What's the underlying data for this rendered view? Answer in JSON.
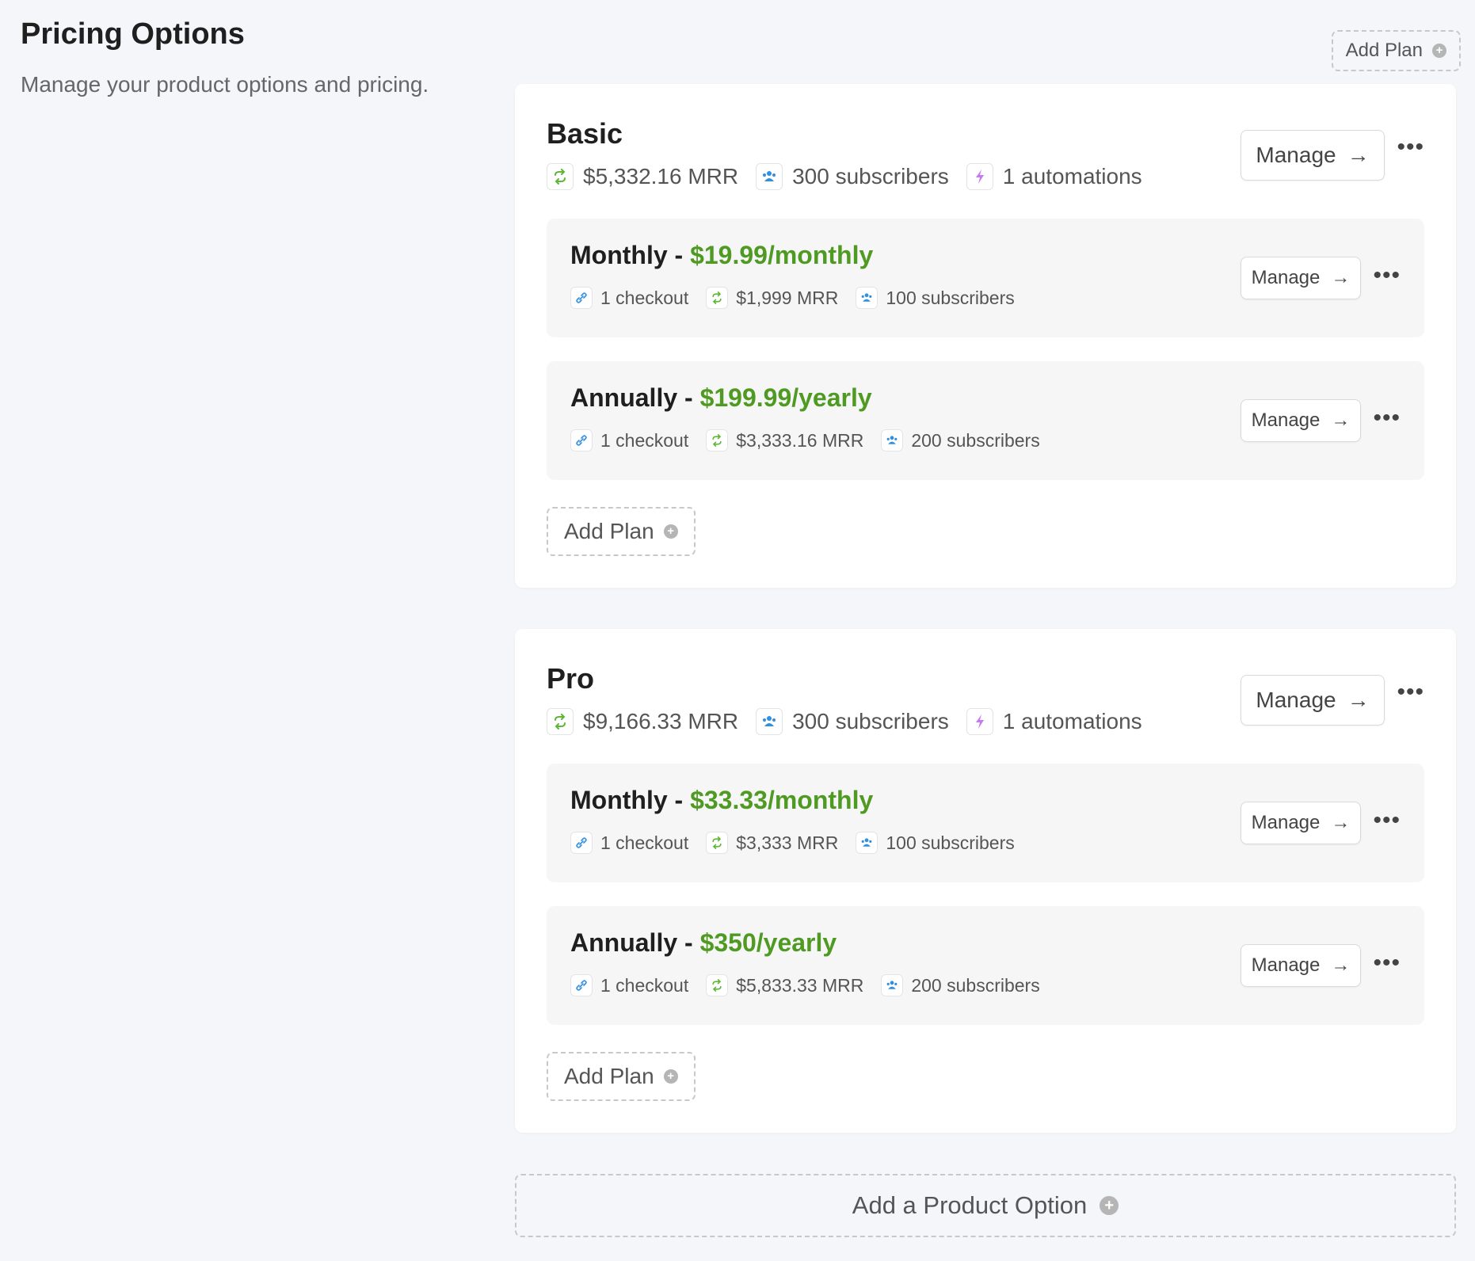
{
  "page": {
    "title": "Pricing Options",
    "subtitle": "Manage your product options and pricing.",
    "add_plan_label": "Add Plan",
    "add_product_option_label": "Add a Product Option"
  },
  "colors": {
    "price": "#4f9a22",
    "mrr_icon": "#5fb536",
    "subscribers_icon": "#2f8fe0",
    "automation_icon": "#c27cf2"
  },
  "products": [
    {
      "name": "Basic",
      "mrr": "$5,332.16 MRR",
      "subscribers": "300 subscribers",
      "automations": "1 automations",
      "manage_label": "Manage",
      "add_plan_label": "Add Plan",
      "plans": [
        {
          "name": "Monthly - ",
          "price": "$19.99/monthly",
          "checkout": "1 checkout",
          "mrr": "$1,999 MRR",
          "subscribers": "100 subscribers",
          "manage_label": "Manage"
        },
        {
          "name": "Annually - ",
          "price": "$199.99/yearly",
          "checkout": "1 checkout",
          "mrr": "$3,333.16 MRR",
          "subscribers": "200 subscribers",
          "manage_label": "Manage"
        }
      ]
    },
    {
      "name": "Pro",
      "mrr": "$9,166.33 MRR",
      "subscribers": "300 subscribers",
      "automations": "1 automations",
      "manage_label": "Manage",
      "add_plan_label": "Add Plan",
      "plans": [
        {
          "name": "Monthly - ",
          "price": "$33.33/monthly",
          "checkout": "1 checkout",
          "mrr": "$3,333 MRR",
          "subscribers": "100 subscribers",
          "manage_label": "Manage"
        },
        {
          "name": "Annually - ",
          "price": "$350/yearly",
          "checkout": "1 checkout",
          "mrr": "$5,833.33 MRR",
          "subscribers": "200 subscribers",
          "manage_label": "Manage"
        }
      ]
    }
  ]
}
